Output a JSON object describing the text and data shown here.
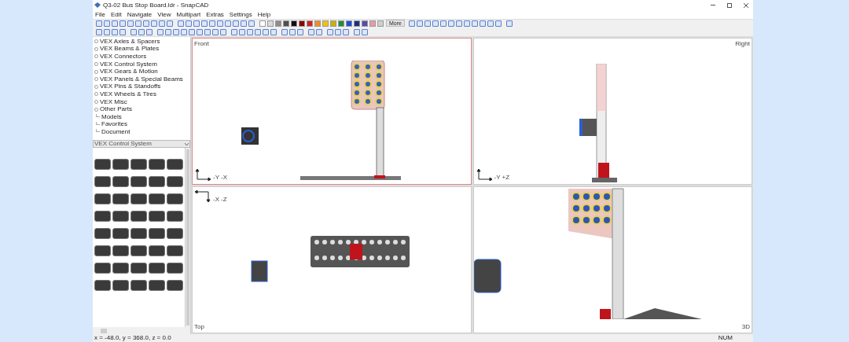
{
  "window": {
    "title": "Q3-02 Bus Stop Board.ldr - SnapCAD"
  },
  "menu": [
    "File",
    "Edit",
    "Navigate",
    "View",
    "Multipart",
    "Extras",
    "Settings",
    "Help"
  ],
  "palette_colors": [
    {
      "color": "#ffffff"
    },
    {
      "color": "#d9d9d9"
    },
    {
      "color": "#8c8c8c"
    },
    {
      "color": "#505050"
    },
    {
      "color": "#111111"
    },
    {
      "color": "#8b0000"
    },
    {
      "color": "#d62020"
    },
    {
      "color": "#f28c28"
    },
    {
      "color": "#f5c400"
    },
    {
      "color": "#c8b400"
    },
    {
      "color": "#1f8f3a"
    },
    {
      "color": "#1e4fd8"
    },
    {
      "color": "#1a2f80"
    },
    {
      "color": "#5a4bb0"
    },
    {
      "color": "#e89aa8"
    },
    {
      "color": "#cfcfcf"
    }
  ],
  "more_button": "More",
  "parts_tree": [
    {
      "label": "VEX Axles & Spacers",
      "kind": "folder"
    },
    {
      "label": "VEX Beams & Plates",
      "kind": "folder"
    },
    {
      "label": "VEX Connectors",
      "kind": "folder"
    },
    {
      "label": "VEX Control System",
      "kind": "folder"
    },
    {
      "label": "VEX Gears & Motion",
      "kind": "folder"
    },
    {
      "label": "VEX Panels & Special Beams",
      "kind": "folder"
    },
    {
      "label": "VEX Pins & Standoffs",
      "kind": "folder"
    },
    {
      "label": "VEX Wheels & Tires",
      "kind": "folder"
    },
    {
      "label": "VEX Misc",
      "kind": "folder"
    },
    {
      "label": "Other Parts",
      "kind": "folder"
    },
    {
      "label": "Models",
      "kind": "leaf"
    },
    {
      "label": "Favorites",
      "kind": "leaf"
    },
    {
      "label": "Document",
      "kind": "leaf"
    }
  ],
  "category_select": {
    "value": "VEX Control System"
  },
  "viewports": [
    {
      "label": "Front",
      "selected": true,
      "axes": [
        "-Y",
        "-X"
      ],
      "kind": "front"
    },
    {
      "label": "Right",
      "selected": false,
      "axes": [
        "-Y",
        "+Z"
      ],
      "kind": "right"
    },
    {
      "label": "Top",
      "selected": false,
      "axes": [
        "-X",
        "-Z"
      ],
      "kind": "top"
    },
    {
      "label": "3D",
      "selected": false,
      "kind": "perspective"
    }
  ],
  "status_bar": {
    "coordinates": "x = -48.0, y = 368.0, z = 0.0",
    "num": "NUM"
  }
}
